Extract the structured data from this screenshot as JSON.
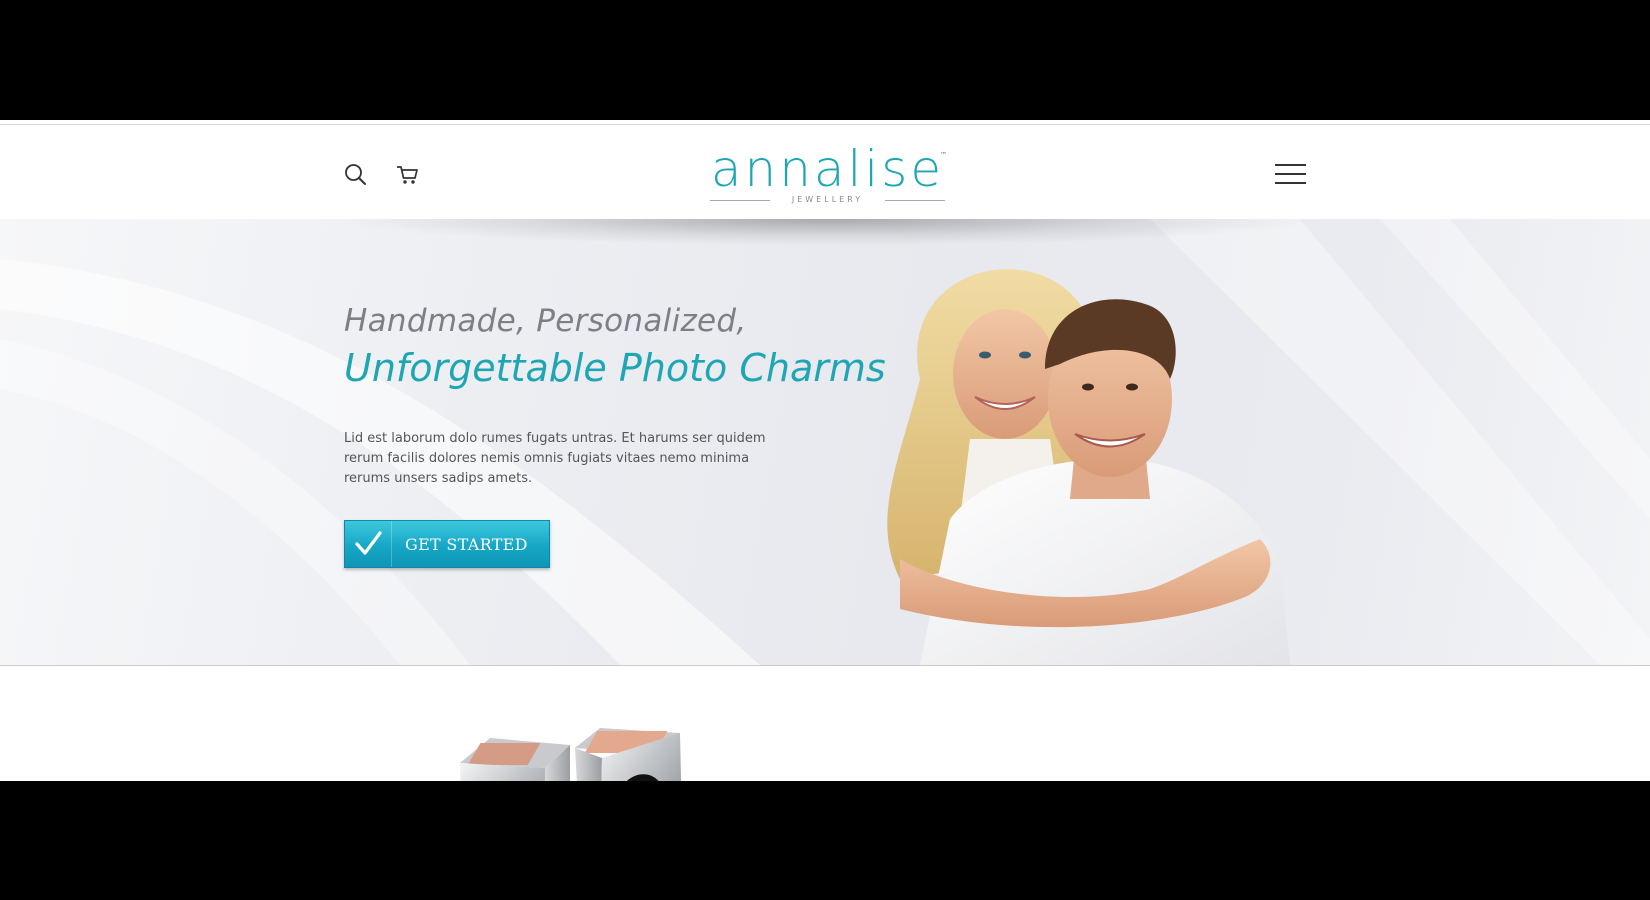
{
  "header": {
    "search_icon": "search-icon",
    "cart_icon": "cart-icon",
    "menu_icon": "hamburger-menu-icon",
    "logo": {
      "word": "annalise",
      "tm": "™",
      "tagline": "JEWELLERY"
    }
  },
  "hero": {
    "headline_line1": "Handmade, Personalized,",
    "headline_line2": "Unforgettable Photo Charms",
    "body": "Lid est laborum dolo rumes fugats untras. Et harums ser quidem rerum facilis dolores nemis omnis fugiats vitaes nemo minima rerums unsers sadips amets.",
    "cta_label": "GET STARTED",
    "cta_icon": "checkmark-icon"
  },
  "colors": {
    "accent": "#1ea6b5",
    "headline_gray": "#7c7f86",
    "body_text": "#555555",
    "cta_top": "#3ec7dc",
    "cta_bottom": "#0f96b6"
  }
}
